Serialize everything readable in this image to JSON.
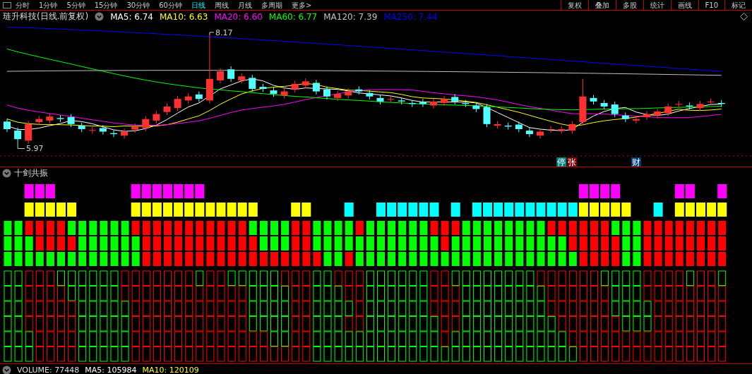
{
  "toolbar": {
    "periods": [
      {
        "label": "分时",
        "selected": false
      },
      {
        "label": "1分钟",
        "selected": false
      },
      {
        "label": "5分钟",
        "selected": false
      },
      {
        "label": "15分钟",
        "selected": false
      },
      {
        "label": "30分钟",
        "selected": false
      },
      {
        "label": "60分钟",
        "selected": false
      },
      {
        "label": "日线",
        "selected": true
      },
      {
        "label": "周线",
        "selected": false
      },
      {
        "label": "月线",
        "selected": false
      },
      {
        "label": "多周期",
        "selected": false
      },
      {
        "label": "更多>",
        "selected": false
      }
    ],
    "buttons": [
      "复权",
      "叠加",
      "多股",
      "统计",
      "画线",
      "F10",
      "标记"
    ]
  },
  "chart": {
    "title": "琏升科技(日线.前复权)",
    "ma": [
      {
        "label": "MA5: 6.74",
        "color": "#ffffff"
      },
      {
        "label": "MA10: 6.63",
        "color": "#ffff00"
      },
      {
        "label": "MA20: 6.60",
        "color": "#ff00ff"
      },
      {
        "label": "MA60: 6.77",
        "color": "#00ff00"
      },
      {
        "label": "MA120: 7.39",
        "color": "#c0c0c0"
      },
      {
        "label": "MA250: 7.44",
        "color": "#0000ff"
      }
    ],
    "high_label": "8.17",
    "low_label": "5.97",
    "markers": [
      {
        "text": "停",
        "color": "#008080"
      },
      {
        "text": "张",
        "color": "#800000"
      },
      {
        "text": "财",
        "color": "#003c78"
      }
    ]
  },
  "indicator": {
    "title": "十剑共振"
  },
  "volume": {
    "label": "VOLUME: 77448",
    "ma": [
      {
        "label": "MA5: 105984",
        "color": "#ffffff"
      },
      {
        "label": "MA10: 120109",
        "color": "#ffff00"
      }
    ]
  }
}
